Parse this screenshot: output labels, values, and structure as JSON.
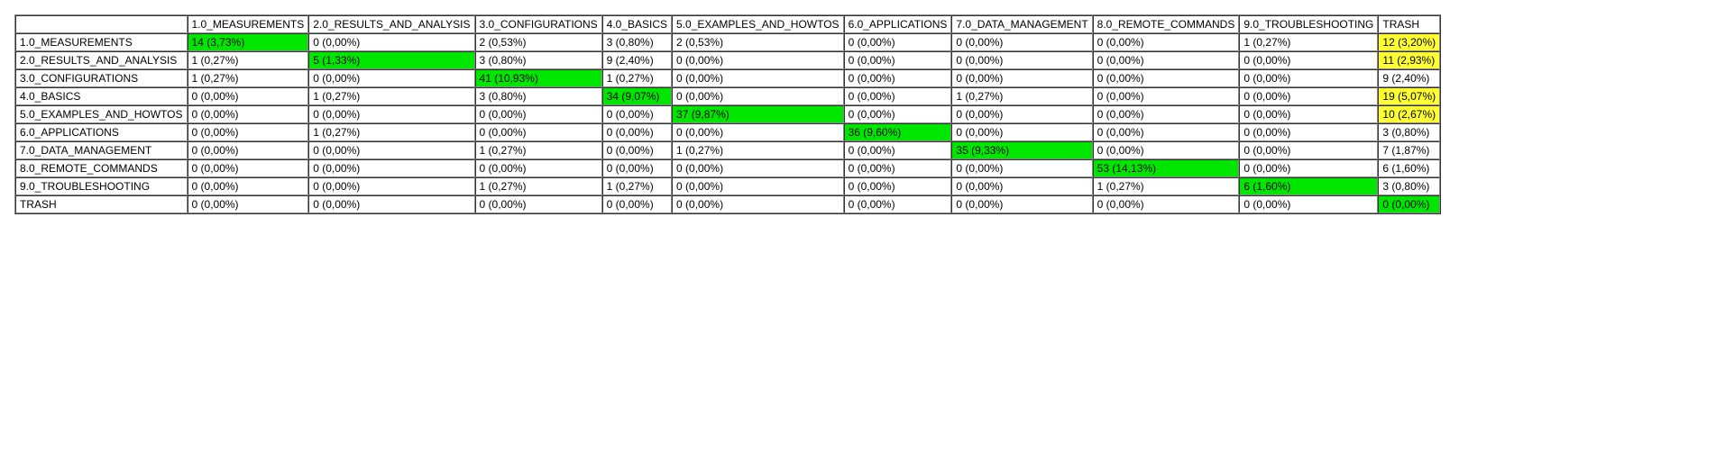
{
  "labels": [
    "1.0_MEASUREMENTS",
    "2.0_RESULTS_AND_ANALYSIS",
    "3.0_CONFIGURATIONS",
    "4.0_BASICS",
    "5.0_EXAMPLES_AND_HOWTOS",
    "6.0_APPLICATIONS",
    "7.0_DATA_MANAGEMENT",
    "8.0_REMOTE_COMMANDS",
    "9.0_TROUBLESHOOTING",
    "TRASH"
  ],
  "cells": [
    [
      {
        "text": "14 (3,73%)",
        "hl": "green"
      },
      {
        "text": "0 (0,00%)",
        "hl": null
      },
      {
        "text": "2 (0,53%)",
        "hl": null
      },
      {
        "text": "3 (0,80%)",
        "hl": null
      },
      {
        "text": "2 (0,53%)",
        "hl": null
      },
      {
        "text": "0 (0,00%)",
        "hl": null
      },
      {
        "text": "0 (0,00%)",
        "hl": null
      },
      {
        "text": "0 (0,00%)",
        "hl": null
      },
      {
        "text": "1 (0,27%)",
        "hl": null
      },
      {
        "text": "12 (3,20%)",
        "hl": "yellow"
      }
    ],
    [
      {
        "text": "1 (0,27%)",
        "hl": null
      },
      {
        "text": "5 (1,33%)",
        "hl": "green"
      },
      {
        "text": "3 (0,80%)",
        "hl": null
      },
      {
        "text": "9 (2,40%)",
        "hl": null
      },
      {
        "text": "0 (0,00%)",
        "hl": null
      },
      {
        "text": "0 (0,00%)",
        "hl": null
      },
      {
        "text": "0 (0,00%)",
        "hl": null
      },
      {
        "text": "0 (0,00%)",
        "hl": null
      },
      {
        "text": "0 (0,00%)",
        "hl": null
      },
      {
        "text": "11 (2,93%)",
        "hl": "yellow"
      }
    ],
    [
      {
        "text": "1 (0,27%)",
        "hl": null
      },
      {
        "text": "0 (0,00%)",
        "hl": null
      },
      {
        "text": "41 (10,93%)",
        "hl": "green"
      },
      {
        "text": "1 (0,27%)",
        "hl": null
      },
      {
        "text": "0 (0,00%)",
        "hl": null
      },
      {
        "text": "0 (0,00%)",
        "hl": null
      },
      {
        "text": "0 (0,00%)",
        "hl": null
      },
      {
        "text": "0 (0,00%)",
        "hl": null
      },
      {
        "text": "0 (0,00%)",
        "hl": null
      },
      {
        "text": "9 (2,40%)",
        "hl": null
      }
    ],
    [
      {
        "text": "0 (0,00%)",
        "hl": null
      },
      {
        "text": "1 (0,27%)",
        "hl": null
      },
      {
        "text": "3 (0,80%)",
        "hl": null
      },
      {
        "text": "34 (9,07%)",
        "hl": "green"
      },
      {
        "text": "0 (0,00%)",
        "hl": null
      },
      {
        "text": "0 (0,00%)",
        "hl": null
      },
      {
        "text": "1 (0,27%)",
        "hl": null
      },
      {
        "text": "0 (0,00%)",
        "hl": null
      },
      {
        "text": "0 (0,00%)",
        "hl": null
      },
      {
        "text": "19 (5,07%)",
        "hl": "yellow"
      }
    ],
    [
      {
        "text": "0 (0,00%)",
        "hl": null
      },
      {
        "text": "0 (0,00%)",
        "hl": null
      },
      {
        "text": "0 (0,00%)",
        "hl": null
      },
      {
        "text": "0 (0,00%)",
        "hl": null
      },
      {
        "text": "37 (9,87%)",
        "hl": "green"
      },
      {
        "text": "0 (0,00%)",
        "hl": null
      },
      {
        "text": "0 (0,00%)",
        "hl": null
      },
      {
        "text": "0 (0,00%)",
        "hl": null
      },
      {
        "text": "0 (0,00%)",
        "hl": null
      },
      {
        "text": "10 (2,67%)",
        "hl": "yellow"
      }
    ],
    [
      {
        "text": "0 (0,00%)",
        "hl": null
      },
      {
        "text": "1 (0,27%)",
        "hl": null
      },
      {
        "text": "0 (0,00%)",
        "hl": null
      },
      {
        "text": "0 (0,00%)",
        "hl": null
      },
      {
        "text": "0 (0,00%)",
        "hl": null
      },
      {
        "text": "36 (9,60%)",
        "hl": "green"
      },
      {
        "text": "0 (0,00%)",
        "hl": null
      },
      {
        "text": "0 (0,00%)",
        "hl": null
      },
      {
        "text": "0 (0,00%)",
        "hl": null
      },
      {
        "text": "3 (0,80%)",
        "hl": null
      }
    ],
    [
      {
        "text": "0 (0,00%)",
        "hl": null
      },
      {
        "text": "0 (0,00%)",
        "hl": null
      },
      {
        "text": "1 (0,27%)",
        "hl": null
      },
      {
        "text": "0 (0,00%)",
        "hl": null
      },
      {
        "text": "1 (0,27%)",
        "hl": null
      },
      {
        "text": "0 (0,00%)",
        "hl": null
      },
      {
        "text": "35 (9,33%)",
        "hl": "green"
      },
      {
        "text": "0 (0,00%)",
        "hl": null
      },
      {
        "text": "0 (0,00%)",
        "hl": null
      },
      {
        "text": "7 (1,87%)",
        "hl": null
      }
    ],
    [
      {
        "text": "0 (0,00%)",
        "hl": null
      },
      {
        "text": "0 (0,00%)",
        "hl": null
      },
      {
        "text": "0 (0,00%)",
        "hl": null
      },
      {
        "text": "0 (0,00%)",
        "hl": null
      },
      {
        "text": "0 (0,00%)",
        "hl": null
      },
      {
        "text": "0 (0,00%)",
        "hl": null
      },
      {
        "text": "0 (0,00%)",
        "hl": null
      },
      {
        "text": "53 (14,13%)",
        "hl": "green"
      },
      {
        "text": "0 (0,00%)",
        "hl": null
      },
      {
        "text": "6 (1,60%)",
        "hl": null
      }
    ],
    [
      {
        "text": "0 (0,00%)",
        "hl": null
      },
      {
        "text": "0 (0,00%)",
        "hl": null
      },
      {
        "text": "1 (0,27%)",
        "hl": null
      },
      {
        "text": "1 (0,27%)",
        "hl": null
      },
      {
        "text": "0 (0,00%)",
        "hl": null
      },
      {
        "text": "0 (0,00%)",
        "hl": null
      },
      {
        "text": "0 (0,00%)",
        "hl": null
      },
      {
        "text": "1 (0,27%)",
        "hl": null
      },
      {
        "text": "6 (1,60%)",
        "hl": "green"
      },
      {
        "text": "3 (0,80%)",
        "hl": null
      }
    ],
    [
      {
        "text": "0 (0,00%)",
        "hl": null
      },
      {
        "text": "0 (0,00%)",
        "hl": null
      },
      {
        "text": "0 (0,00%)",
        "hl": null
      },
      {
        "text": "0 (0,00%)",
        "hl": null
      },
      {
        "text": "0 (0,00%)",
        "hl": null
      },
      {
        "text": "0 (0,00%)",
        "hl": null
      },
      {
        "text": "0 (0,00%)",
        "hl": null
      },
      {
        "text": "0 (0,00%)",
        "hl": null
      },
      {
        "text": "0 (0,00%)",
        "hl": null
      },
      {
        "text": "0 (0,00%)",
        "hl": "green"
      }
    ]
  ],
  "chart_data": {
    "type": "table",
    "title": "Confusion matrix (counts and percentages)",
    "row_labels": [
      "1.0_MEASUREMENTS",
      "2.0_RESULTS_AND_ANALYSIS",
      "3.0_CONFIGURATIONS",
      "4.0_BASICS",
      "5.0_EXAMPLES_AND_HOWTOS",
      "6.0_APPLICATIONS",
      "7.0_DATA_MANAGEMENT",
      "8.0_REMOTE_COMMANDS",
      "9.0_TROUBLESHOOTING",
      "TRASH"
    ],
    "col_labels": [
      "1.0_MEASUREMENTS",
      "2.0_RESULTS_AND_ANALYSIS",
      "3.0_CONFIGURATIONS",
      "4.0_BASICS",
      "5.0_EXAMPLES_AND_HOWTOS",
      "6.0_APPLICATIONS",
      "7.0_DATA_MANAGEMENT",
      "8.0_REMOTE_COMMANDS",
      "9.0_TROUBLESHOOTING",
      "TRASH"
    ],
    "counts": [
      [
        14,
        0,
        2,
        3,
        2,
        0,
        0,
        0,
        1,
        12
      ],
      [
        1,
        5,
        3,
        9,
        0,
        0,
        0,
        0,
        0,
        11
      ],
      [
        1,
        0,
        41,
        1,
        0,
        0,
        0,
        0,
        0,
        9
      ],
      [
        0,
        1,
        3,
        34,
        0,
        0,
        1,
        0,
        0,
        19
      ],
      [
        0,
        0,
        0,
        0,
        37,
        0,
        0,
        0,
        0,
        10
      ],
      [
        0,
        1,
        0,
        0,
        0,
        36,
        0,
        0,
        0,
        3
      ],
      [
        0,
        0,
        1,
        0,
        1,
        0,
        35,
        0,
        0,
        7
      ],
      [
        0,
        0,
        0,
        0,
        0,
        0,
        0,
        53,
        0,
        6
      ],
      [
        0,
        0,
        1,
        1,
        0,
        0,
        0,
        1,
        6,
        3
      ],
      [
        0,
        0,
        0,
        0,
        0,
        0,
        0,
        0,
        0,
        0
      ]
    ],
    "percentages": [
      [
        3.73,
        0.0,
        0.53,
        0.8,
        0.53,
        0.0,
        0.0,
        0.0,
        0.27,
        3.2
      ],
      [
        0.27,
        1.33,
        0.8,
        2.4,
        0.0,
        0.0,
        0.0,
        0.0,
        0.0,
        2.93
      ],
      [
        0.27,
        0.0,
        10.93,
        0.27,
        0.0,
        0.0,
        0.0,
        0.0,
        0.0,
        2.4
      ],
      [
        0.0,
        0.27,
        0.8,
        9.07,
        0.0,
        0.0,
        0.27,
        0.0,
        0.0,
        5.07
      ],
      [
        0.0,
        0.0,
        0.0,
        0.0,
        9.87,
        0.0,
        0.0,
        0.0,
        0.0,
        2.67
      ],
      [
        0.0,
        0.27,
        0.0,
        0.0,
        0.0,
        9.6,
        0.0,
        0.0,
        0.0,
        0.8
      ],
      [
        0.0,
        0.0,
        0.27,
        0.0,
        0.27,
        0.0,
        9.33,
        0.0,
        0.0,
        1.87
      ],
      [
        0.0,
        0.0,
        0.0,
        0.0,
        0.0,
        0.0,
        0.0,
        14.13,
        0.0,
        1.6
      ],
      [
        0.0,
        0.0,
        0.27,
        0.27,
        0.0,
        0.0,
        0.0,
        0.27,
        1.6,
        0.8
      ],
      [
        0.0,
        0.0,
        0.0,
        0.0,
        0.0,
        0.0,
        0.0,
        0.0,
        0.0,
        0.0
      ]
    ],
    "highlight": {
      "green_cells": "diagonal cells (row label == col label)",
      "yellow_cells": "rows 0,1,3,4 in final TRASH column"
    }
  }
}
